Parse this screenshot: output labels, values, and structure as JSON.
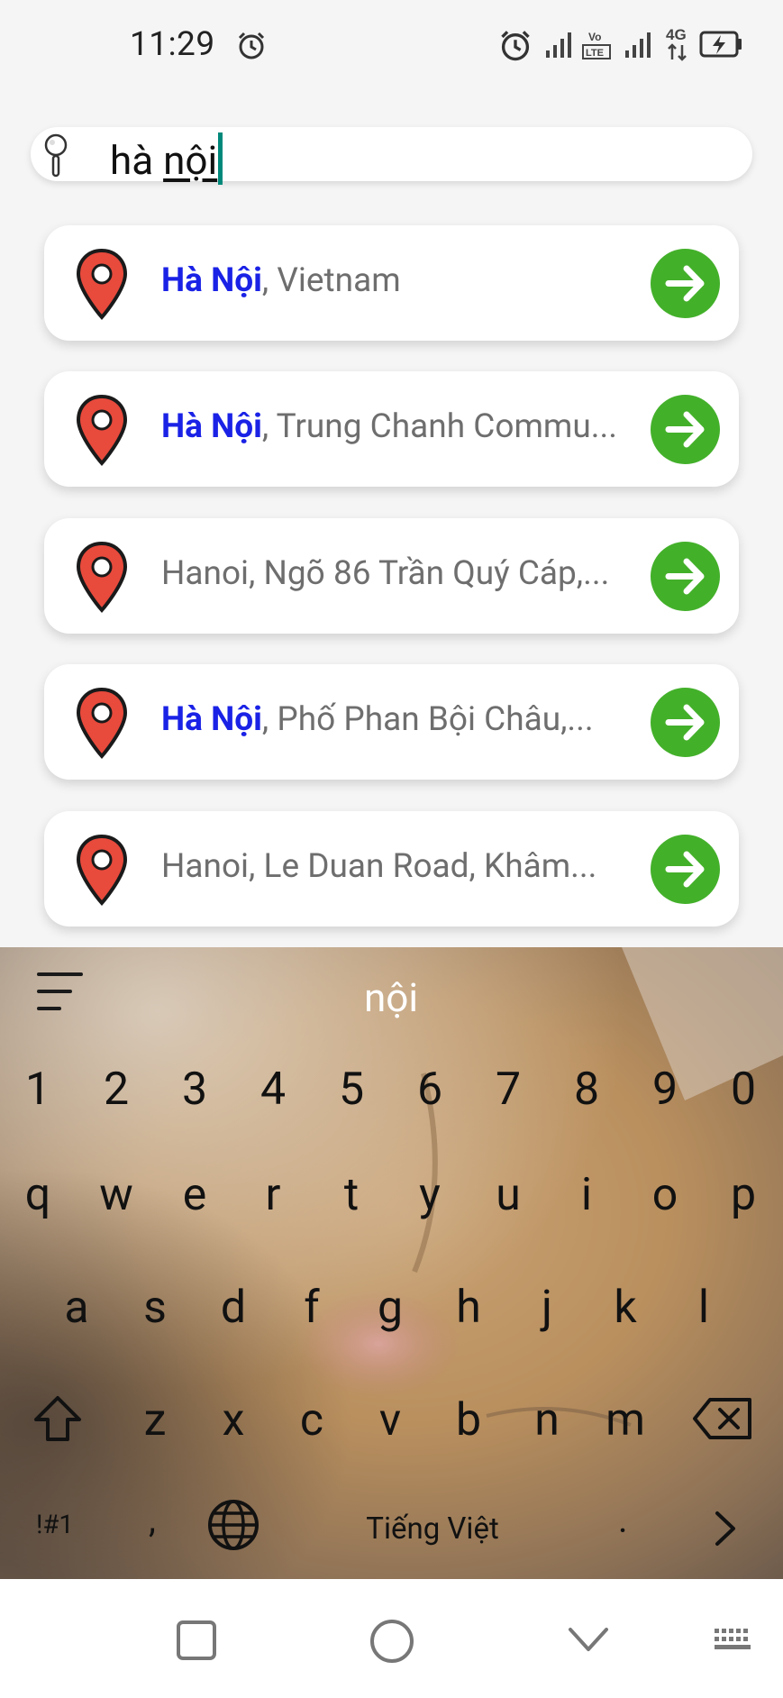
{
  "status_bar": {
    "time": "11:29",
    "icons": [
      "alarm-icon",
      "signal-icon",
      "volte-icon",
      "4g-icon",
      "battery-charging-icon"
    ]
  },
  "search": {
    "prefix": "hà ",
    "composing": "nội",
    "icon": "search-icon"
  },
  "results": [
    {
      "highlight": "Hà Nội",
      "rest": ", Vietnam"
    },
    {
      "highlight": "Hà Nội",
      "rest": ", Trung Chanh Commu..."
    },
    {
      "highlight": "",
      "rest": "Hanoi, Ngõ 86 Trần Quý Cáp,..."
    },
    {
      "highlight": "Hà Nội",
      "rest": ", Phố Phan Bội Châu,..."
    },
    {
      "highlight": "",
      "rest": "Hanoi, Le Duan Road, Khâm..."
    }
  ],
  "colors": {
    "highlight": "#1a22e6",
    "go_button": "#43b02a",
    "pin": "#e84a3c",
    "caret": "#00897b"
  },
  "keyboard": {
    "suggestion": "nội",
    "numbers": [
      "1",
      "2",
      "3",
      "4",
      "5",
      "6",
      "7",
      "8",
      "9",
      "0"
    ],
    "row1": [
      "q",
      "w",
      "e",
      "r",
      "t",
      "y",
      "u",
      "i",
      "o",
      "p"
    ],
    "row2": [
      "a",
      "s",
      "d",
      "f",
      "g",
      "h",
      "j",
      "k",
      "l"
    ],
    "row3": [
      "z",
      "x",
      "c",
      "v",
      "b",
      "n",
      "m"
    ],
    "symbols_label": "!#1",
    "comma_label": ",",
    "space_label": "Tiếng Việt",
    "period_label": "."
  }
}
